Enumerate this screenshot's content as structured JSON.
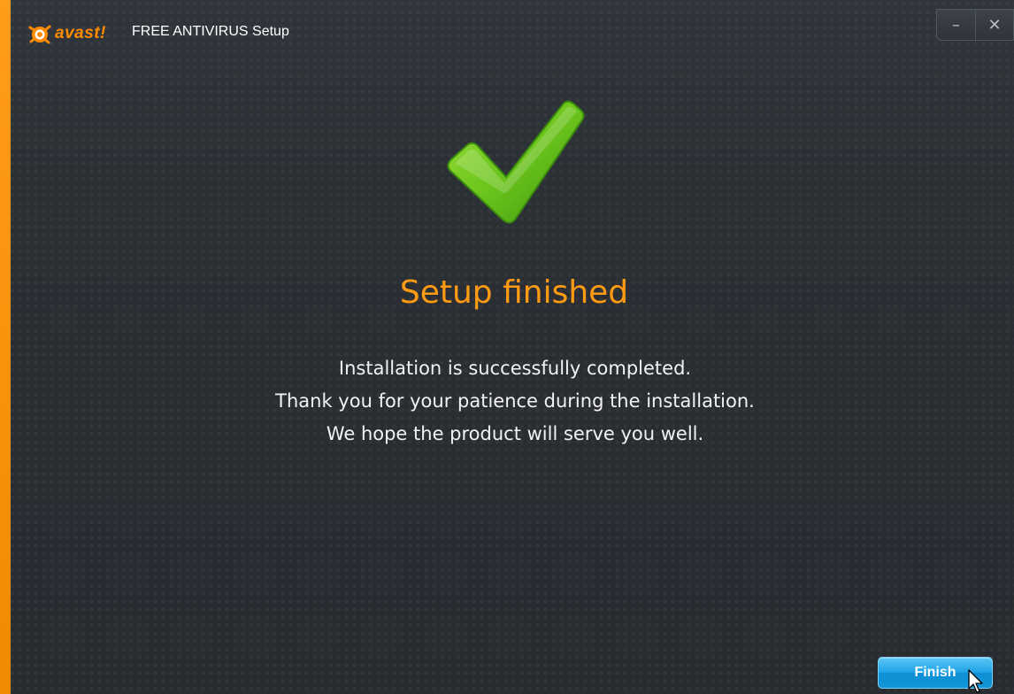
{
  "window": {
    "brand_word": "avast!",
    "title": "FREE ANTIVIRUS Setup",
    "minimize_glyph": "–",
    "close_glyph": "✕"
  },
  "main": {
    "icon": "checkmark-icon",
    "heading": "Setup finished",
    "lines": [
      "Installation is successfully completed.",
      "Thank you for your patience during the installation.",
      "We hope the product will serve you well."
    ]
  },
  "footer": {
    "finish_label": "Finish"
  },
  "colors": {
    "accent": "#f7931e",
    "heading": "#ff9a13",
    "background": "#2a2e33",
    "check_green": "#6cc51c",
    "button_blue": "#1fa4e6"
  }
}
